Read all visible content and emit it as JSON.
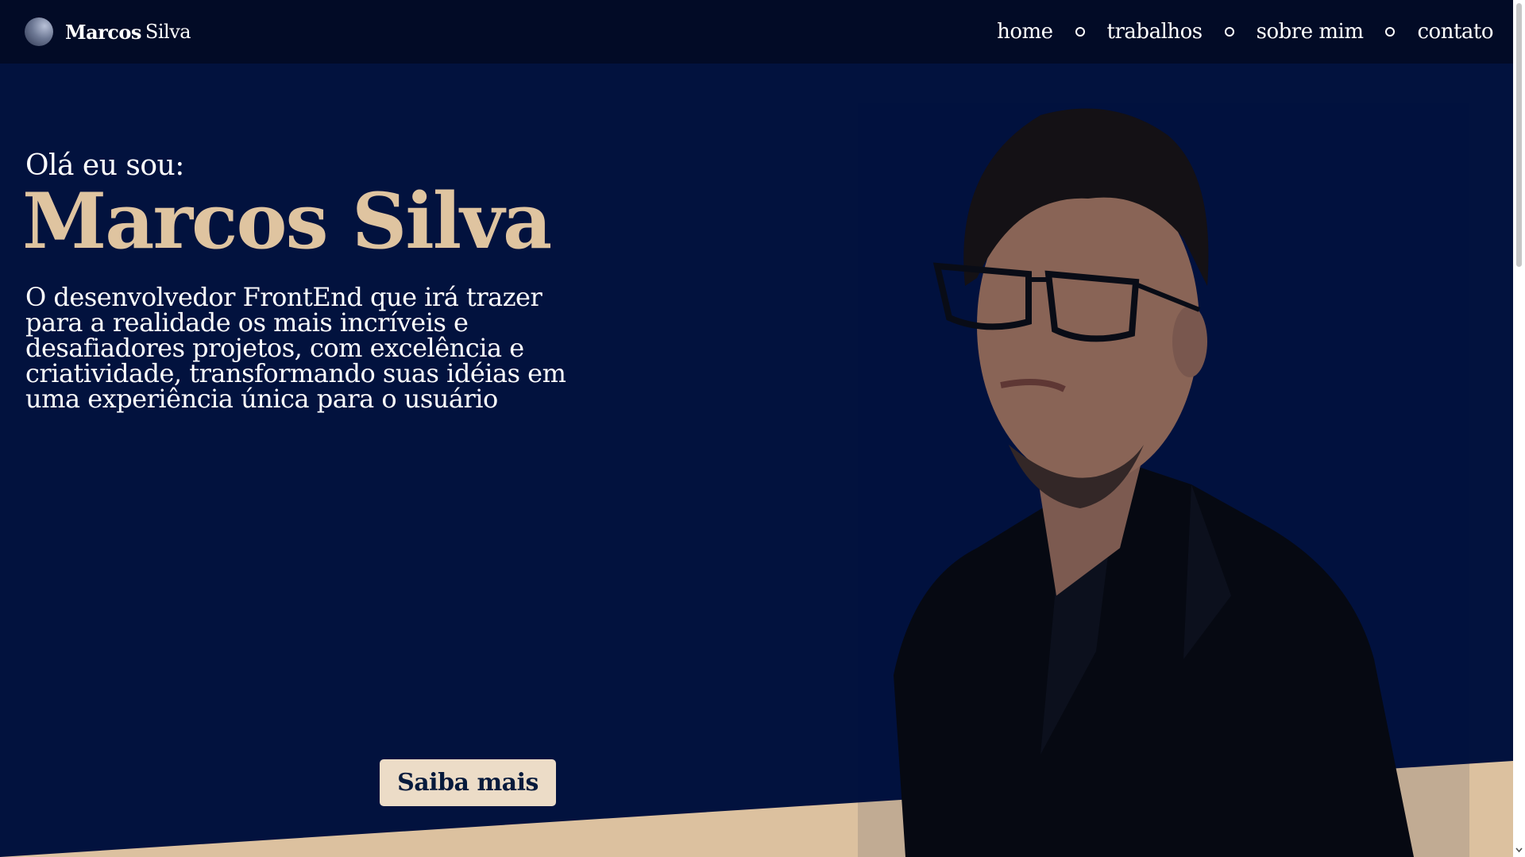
{
  "brand": {
    "first": "Marcos",
    "last": "Silva",
    "logo_icon": "sphere-logo-icon"
  },
  "nav": {
    "items": [
      {
        "label": "home"
      },
      {
        "label": "trabalhos"
      },
      {
        "label": "sobre mim"
      },
      {
        "label": "contato"
      }
    ],
    "separator_icon": "circle-dot-icon"
  },
  "hero": {
    "greeting": "Olá eu sou:",
    "name": "Marcos Silva",
    "description": "O desenvolvedor FrontEnd que irá trazer para a realidade os mais incríveis e desafiadores projetos, com excelência e criatividade, transformando suas idéias em uma experiência única para o usuário",
    "button_label": "Saiba mais"
  },
  "colors": {
    "background": "#02123e",
    "header": "#020b26",
    "accent": "#dfc4a0",
    "button": "#ecdcc7",
    "button_text": "#061a3c"
  }
}
